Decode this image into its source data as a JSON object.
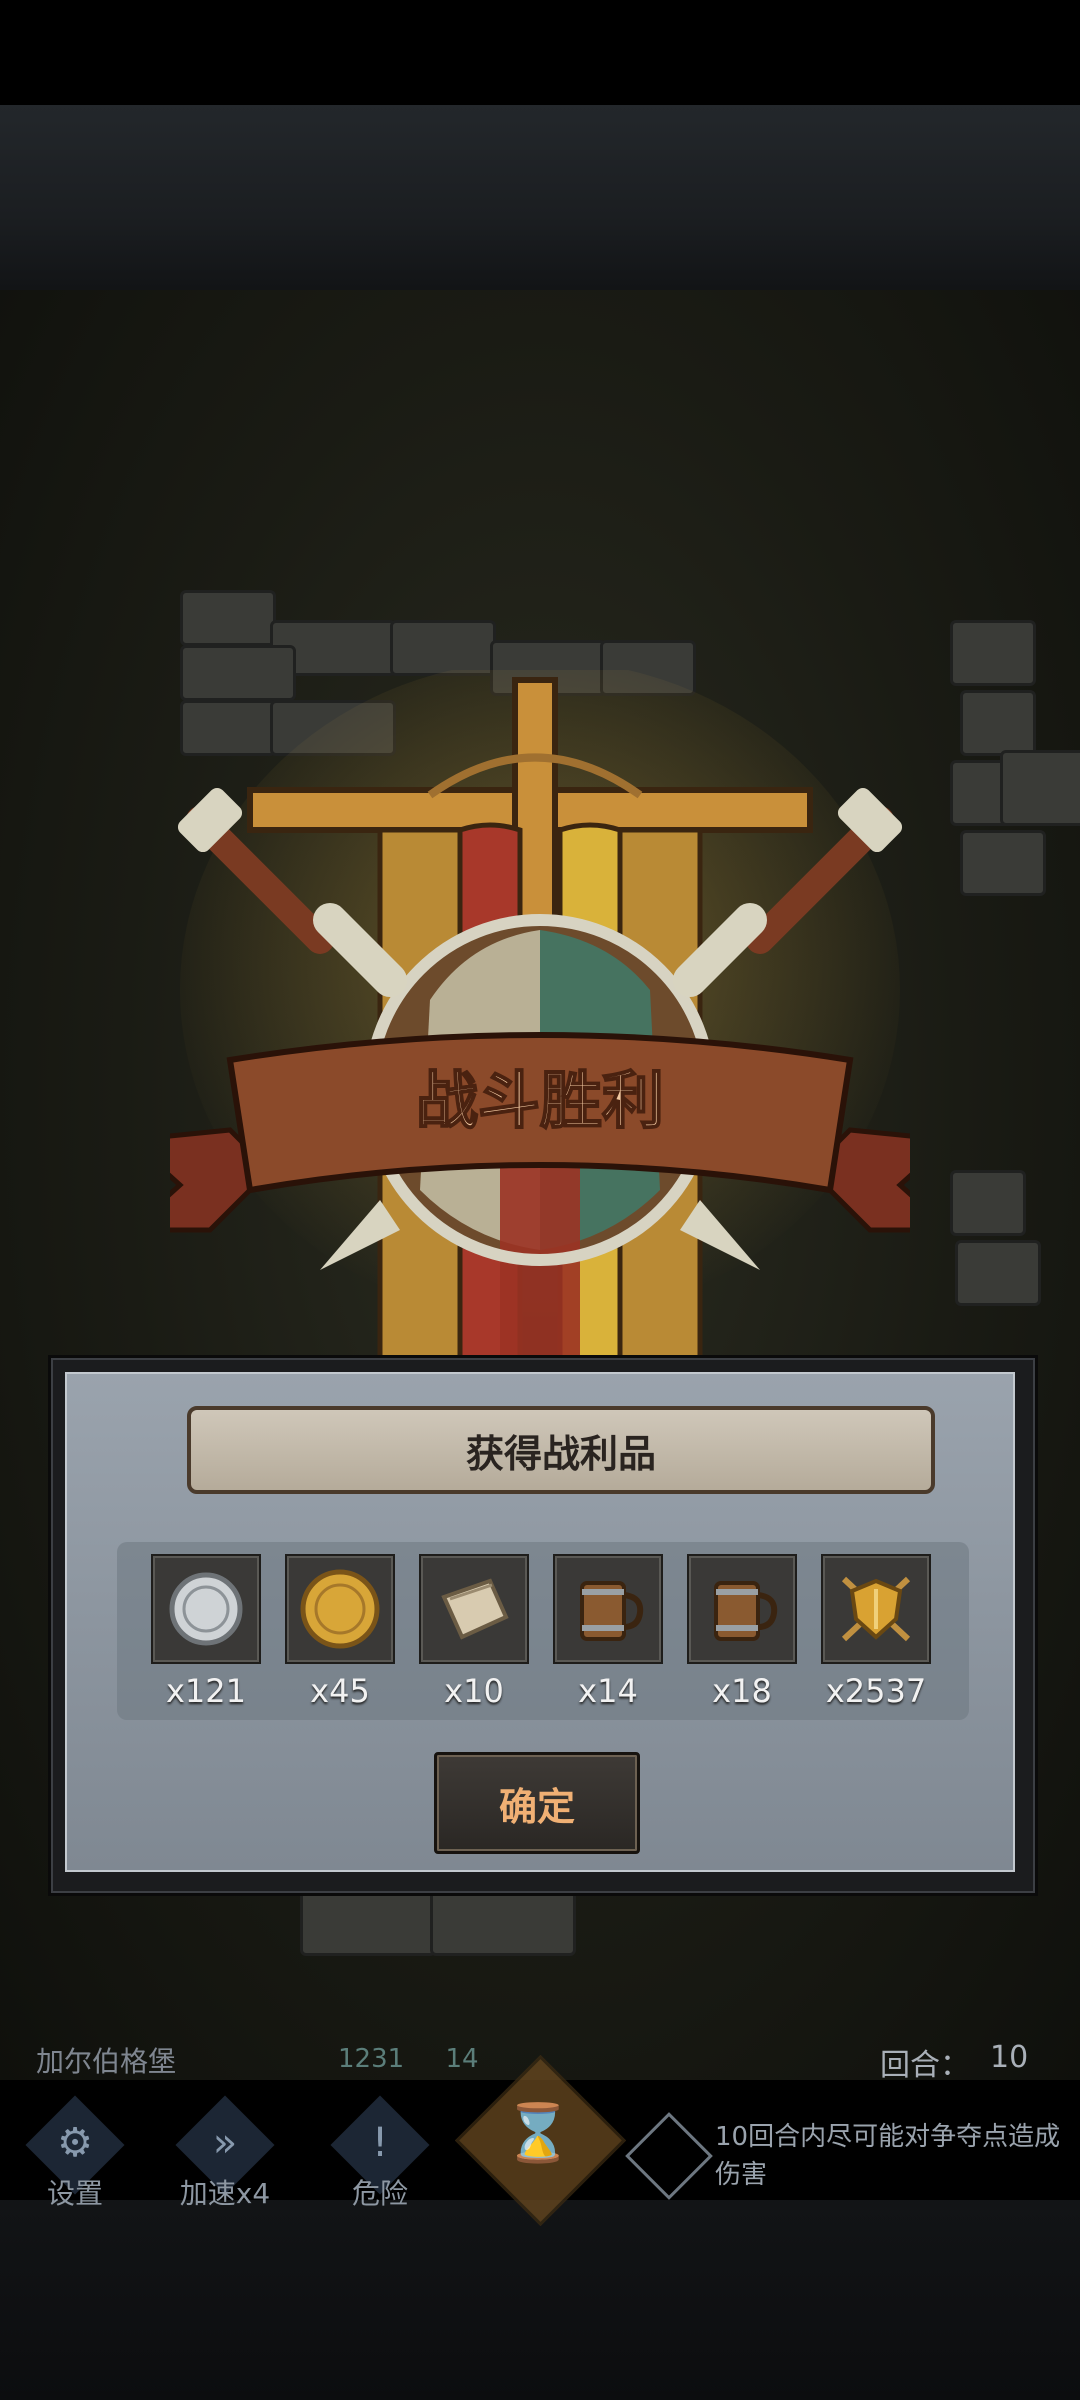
{
  "victory_banner": {
    "title": "战斗胜利"
  },
  "loot": {
    "header": "获得战利品",
    "items": [
      {
        "name": "silver-coin",
        "count": "x121"
      },
      {
        "name": "gold-coin",
        "count": "x45"
      },
      {
        "name": "scroll",
        "count": "x10"
      },
      {
        "name": "mug",
        "count": "x14"
      },
      {
        "name": "mug",
        "count": "x18"
      },
      {
        "name": "shield-emblem",
        "count": "x2537"
      }
    ],
    "confirm_label": "确定"
  },
  "status": {
    "location": "加尔伯格堡",
    "score": "1231",
    "score_small": "14",
    "round_label": "回合：",
    "round_value": "10"
  },
  "controls": {
    "settings": "设置",
    "speed": "加速x4",
    "danger": "危险",
    "hint": "10回合内尽可能对争夺点造成伤害"
  },
  "colors": {
    "accent": "#f0b074",
    "banner_red": "#8b4a2a",
    "panel": "#8c959f"
  }
}
